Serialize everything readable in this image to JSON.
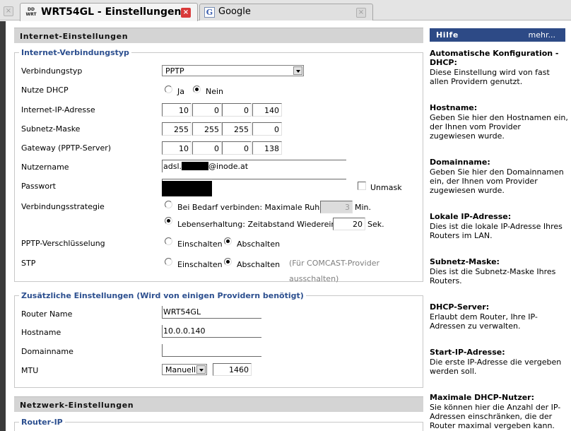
{
  "tabs": [
    {
      "title": "WRT54GL - Einstellungen",
      "favicon": "dd-wrt-icon",
      "favicon_text": "DD WRT",
      "active": true
    },
    {
      "title": "Google",
      "favicon": "google-icon",
      "favicon_text": "G",
      "active": false
    }
  ],
  "icons": {
    "close": "×"
  },
  "internet": {
    "header": "Internet-Einstellungen",
    "legend": "Internet-Verbindungstyp",
    "fields": {
      "connection_type": {
        "label": "Verbindungstyp",
        "value": "PPTP"
      },
      "dhcp": {
        "label": "Nutze DHCP",
        "yes": "Ja",
        "no": "Nein",
        "selected": "Nein"
      },
      "ip": {
        "label": "Internet-IP-Adresse",
        "octets": [
          "10",
          "0",
          "0",
          "140"
        ]
      },
      "subnet": {
        "label": "Subnetz-Maske",
        "octets": [
          "255",
          "255",
          "255",
          "0"
        ]
      },
      "gateway": {
        "label": "Gateway (PPTP-Server)",
        "octets": [
          "10",
          "0",
          "0",
          "138"
        ]
      },
      "username": {
        "label": "Nutzername",
        "prefix": "adsl.",
        "suffix": "@inode.at"
      },
      "password": {
        "label": "Passwort",
        "unmask": "Unmask"
      },
      "strategy": {
        "label": "Verbindungsstrategie",
        "ondemand": "Bei Bedarf verbinden: Maximale Ruhezeit",
        "ondemand_value": "3",
        "ondemand_unit": "Min.",
        "keepalive": "Lebenserhaltung: Zeitabstand Wiedereinwahl",
        "keepalive_value": "20",
        "keepalive_unit": "Sek.",
        "selected": "keepalive"
      },
      "pptp_enc": {
        "label": "PPTP-Verschlüsselung",
        "on": "Einschalten",
        "off": "Abschalten",
        "selected": "off"
      },
      "stp": {
        "label": "STP",
        "on": "Einschalten",
        "off": "Abschalten",
        "selected": "off",
        "hint_line1": "(Für COMCAST-Provider",
        "hint_line2": "ausschalten)"
      }
    }
  },
  "additional": {
    "legend": "Zusätzliche Einstellungen (Wird von einigen Providern benötigt)",
    "router_name": {
      "label": "Router Name",
      "value": "WRT54GL"
    },
    "hostname": {
      "label": "Hostname",
      "value": "10.0.0.140"
    },
    "domain": {
      "label": "Domainname",
      "value": ""
    },
    "mtu": {
      "label": "MTU",
      "mode": "Manuell",
      "value": "1460"
    }
  },
  "network": {
    "header": "Netzwerk-Einstellungen",
    "legend": "Router-IP"
  },
  "help": {
    "title": "Hilfe",
    "more": "mehr...",
    "items": [
      {
        "heading": "Automatische Konfiguration - DHCP:",
        "body": "Diese Einstellung wird von fast allen Providern genutzt."
      },
      {
        "heading": "Hostname:",
        "body": "Geben Sie hier den Hostnamen ein, der Ihnen vom Provider zugewiesen wurde."
      },
      {
        "heading": "Domainname:",
        "body": "Geben Sie hier den Domainnamen ein, der Ihnen vom Provider zugewiesen wurde."
      },
      {
        "heading": "Lokale IP-Adresse:",
        "body": "Dies ist die lokale IP-Adresse Ihres Routers im LAN."
      },
      {
        "heading": "Subnetz-Maske:",
        "body": "Dies ist die Subnetz-Maske Ihres Routers."
      },
      {
        "heading": "DHCP-Server:",
        "body": "Erlaubt dem Router, Ihre IP-Adressen zu verwalten."
      },
      {
        "heading": "Start-IP-Adresse:",
        "body": "Die erste IP-Adresse die vergeben werden soll."
      },
      {
        "heading": "Maximale DHCP-Nutzer:",
        "body": "Sie können hier die Anzahl der IP-Adressen einschränken, die der Router maximal vergeben kann."
      }
    ]
  }
}
